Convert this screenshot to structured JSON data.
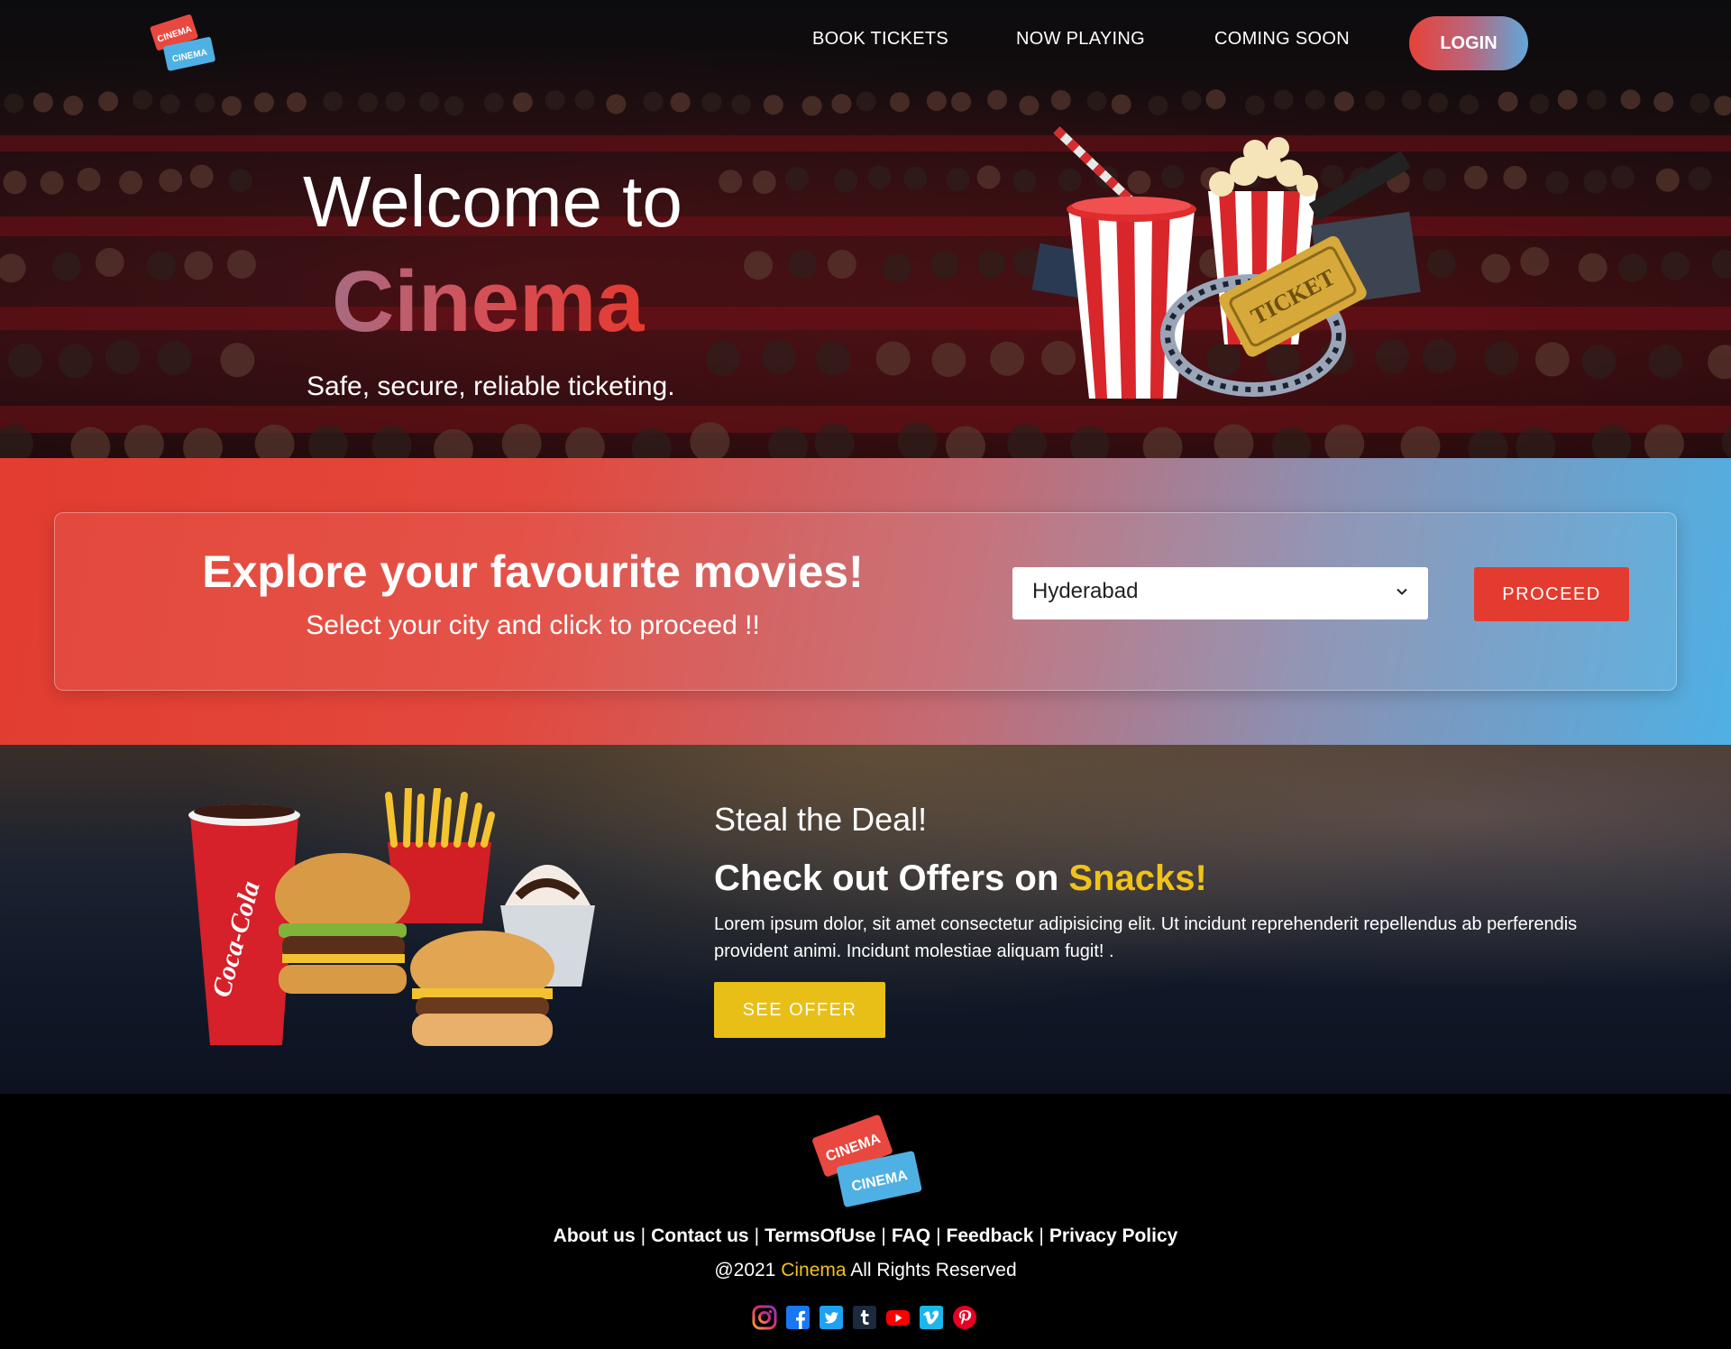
{
  "header": {
    "logo_text_top": "CINEMA",
    "logo_text_bottom": "CINEMA",
    "nav": [
      {
        "label": "BOOK TICKETS"
      },
      {
        "label": "NOW PLAYING"
      },
      {
        "label": "COMING SOON"
      }
    ],
    "login_label": "LOGIN"
  },
  "hero": {
    "welcome": "Welcome to",
    "brand": "Cinema",
    "tagline": "Safe, secure, reliable ticketing.",
    "art_ticket_text": "TICKET"
  },
  "explore": {
    "title": "Explore your favourite movies!",
    "subtitle": "Select your city and click to proceed !!",
    "city_selected": "Hyderabad",
    "proceed_label": "PROCEED"
  },
  "snacks": {
    "pretitle": "Steal the Deal!",
    "title_prefix": "Check out Offers on ",
    "title_highlight": "Snacks!",
    "body": "Lorem ipsum dolor, sit amet consectetur adipisicing elit. Ut incidunt reprehenderit repellendus ab perferendis provident animi. Incidunt molestiae aliquam fugit! .",
    "cta_label": "SEE OFFER",
    "cup_text": "Coca-Cola"
  },
  "footer": {
    "links": [
      {
        "label": "About us"
      },
      {
        "label": "Contact us"
      },
      {
        "label": "TermsOfUse"
      },
      {
        "label": "FAQ"
      },
      {
        "label": "Feedback"
      },
      {
        "label": "Privacy Policy"
      }
    ],
    "link_separator": "|",
    "copyright_prefix": "@2021 ",
    "copyright_brand": "Cinema",
    "copyright_suffix": " All Rights Reserved",
    "socials": [
      "instagram-icon",
      "facebook-icon",
      "twitter-icon",
      "tumblr-icon",
      "youtube-icon",
      "vimeo-icon",
      "pinterest-icon"
    ]
  },
  "colors": {
    "accent_red": "#e33b2f",
    "accent_blue": "#4fb0e4",
    "accent_yellow": "#f0c21a"
  }
}
